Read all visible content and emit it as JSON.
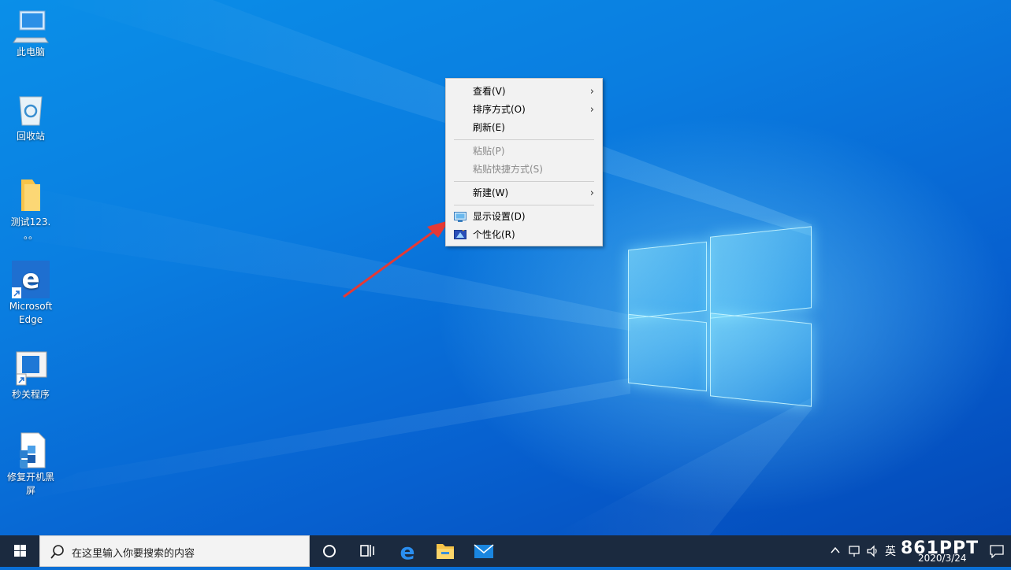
{
  "desktop": {
    "icons": [
      {
        "label": "此电脑",
        "icon": "computer-icon"
      },
      {
        "label": "回收站",
        "icon": "recycle-bin-icon"
      },
      {
        "label": "测试123.",
        "label2": "。。",
        "icon": "folder-icon"
      },
      {
        "label": "Microsoft",
        "label2": "Edge",
        "icon": "edge-icon"
      },
      {
        "label": "秒关程序",
        "icon": "window-shortcut-icon"
      },
      {
        "label": "修复开机黑",
        "label2": "屏",
        "icon": "repair-script-icon"
      }
    ]
  },
  "context_menu": {
    "items": [
      {
        "label": "查看(V)",
        "has_submenu": true,
        "disabled": false
      },
      {
        "label": "排序方式(O)",
        "has_submenu": true,
        "disabled": false
      },
      {
        "label": "刷新(E)",
        "has_submenu": false,
        "disabled": false
      },
      {
        "label": "粘贴(P)",
        "has_submenu": false,
        "disabled": true
      },
      {
        "label": "粘贴快捷方式(S)",
        "has_submenu": false,
        "disabled": true
      },
      {
        "label": "新建(W)",
        "has_submenu": true,
        "disabled": false
      },
      {
        "label": "显示设置(D)",
        "has_submenu": false,
        "disabled": false,
        "icon": "display-settings-icon"
      },
      {
        "label": "个性化(R)",
        "has_submenu": false,
        "disabled": false,
        "icon": "personalize-icon"
      }
    ],
    "submenu_glyph": "›"
  },
  "taskbar": {
    "search_placeholder": "在这里输入你要搜索的内容",
    "apps": [
      "cortana-icon",
      "task-view-icon",
      "edge-icon",
      "file-explorer-icon",
      "mail-icon"
    ],
    "tray": {
      "ime": "英",
      "watermark": "861PPT",
      "date": "2020/3/24"
    }
  },
  "colors": {
    "taskbar": "#1b2a3f",
    "menu_bg": "#f2f2f2",
    "annotation_arrow": "#e53935"
  }
}
